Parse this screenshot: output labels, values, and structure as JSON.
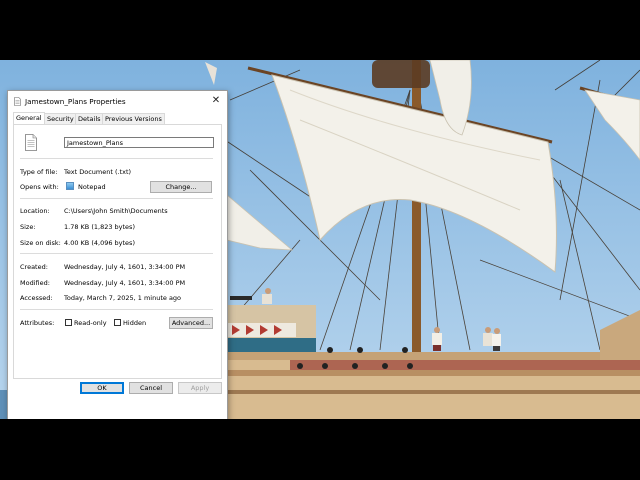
{
  "dialog": {
    "title": "Jamestown_Plans Properties",
    "close_glyph": "✕"
  },
  "tabs": [
    "General",
    "Security",
    "Details",
    "Previous Versions"
  ],
  "general": {
    "file_name": "Jamestown_Plans",
    "type_label": "Type of file:",
    "type_value": "Text Document (.txt)",
    "opens_label": "Opens with:",
    "opens_value": "Notepad",
    "change_button": "Change...",
    "location_label": "Location:",
    "location_value": "C:\\Users\\John Smith\\Documents",
    "size_label": "Size:",
    "size_value": "1.78 KB (1,823 bytes)",
    "disk_label": "Size on disk:",
    "disk_value": "4.00 KB (4,096 bytes)",
    "created_label": "Created:",
    "created_value": "Wednesday, July 4, 1601, 3:34:00 PM",
    "modified_label": "Modified:",
    "modified_value": "Wednesday, July 4, 1601, 3:34:00 PM",
    "accessed_label": "Accessed:",
    "accessed_value": "Today, March 7, 2025, 1 minute ago",
    "attributes_label": "Attributes:",
    "readonly_label": "Read-only",
    "hidden_label": "Hidden",
    "advanced_button": "Advanced..."
  },
  "footer": {
    "ok": "OK",
    "cancel": "Cancel",
    "apply": "Apply"
  },
  "icons": {
    "file": "text-document-icon",
    "notepad": "notepad-icon",
    "close": "close-icon"
  },
  "colors": {
    "sky": "#9cc3e3",
    "sail": "#f3f1ea",
    "hull": "#d7b98d",
    "accent": "#0078d7"
  }
}
